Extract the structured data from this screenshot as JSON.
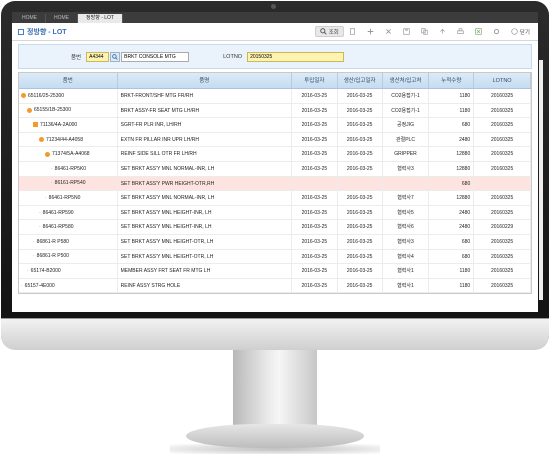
{
  "tabs": [
    {
      "label": "HOME"
    },
    {
      "label": "HOME"
    },
    {
      "label": "정방향 - LOT"
    }
  ],
  "page_title": "정방향 - LOT",
  "toolbar": [
    "조회",
    "",
    "",
    "",
    "",
    "",
    "",
    "",
    "",
    "",
    "닫기"
  ],
  "search": {
    "part_label": "품번",
    "part_code": "A4344",
    "part_name": "BRKT CONSOLE MTG",
    "lot_label": "LOTNO",
    "lot_value": "20150325"
  },
  "grid": {
    "headers": [
      "품번",
      "품명",
      "투입일자",
      "생산/입고일자",
      "생산처/입고처",
      "누적수량",
      "LOTNO"
    ],
    "rows": [
      {
        "level": 0,
        "marker": "dot",
        "part_no": "65116/25-25300",
        "name": "BRKT-FRONT/SHF MTG FR/RH",
        "input_date": "2016-03-25",
        "prod_date": "2016-03-25",
        "location": "CO2용접기-1",
        "qty": "1180",
        "lot": "20160325",
        "highlight": false
      },
      {
        "level": 1,
        "marker": "dot",
        "part_no": "65155/1B-25300",
        "name": "BRKT ASSY-FR SEAT MTG LH/RH",
        "input_date": "2016-03-25",
        "prod_date": "2016-03-25",
        "location": "CO2용접기-1",
        "qty": "1180",
        "lot": "20160325",
        "highlight": false
      },
      {
        "level": 2,
        "marker": "sq",
        "part_no": "71136/4A-2A000",
        "name": "SGRT-FR PLR INR, LH/RH",
        "input_date": "2016-03-25",
        "prod_date": "2016-03-25",
        "location": "공정JIG",
        "qty": "680",
        "lot": "20160325",
        "highlight": false
      },
      {
        "level": 3,
        "marker": "dot",
        "part_no": "71234/44-A4058",
        "name": "EXTN FR PILLAR INR UPR LH/RH",
        "input_date": "2016-03-25",
        "prod_date": "2016-03-25",
        "location": "관절PLC",
        "qty": "2480",
        "lot": "20160325",
        "highlight": false
      },
      {
        "level": 4,
        "marker": "dot",
        "part_no": "71374/5A-A4068",
        "name": "REINF SIDE SILL OTR FR LH/RH",
        "input_date": "2016-03-25",
        "prod_date": "2016-03-25",
        "location": "GRIPPER",
        "qty": "12880",
        "lot": "20160325",
        "highlight": false
      },
      {
        "level": 5,
        "marker": "leaf",
        "part_no": "86461-RP5K0",
        "name": "SET BRKT ASS'Y MNL NORMAL-INR, LH",
        "input_date": "2016-03-25",
        "prod_date": "2016-03-25",
        "location": "협력사3",
        "qty": "12880",
        "lot": "20160325",
        "highlight": false
      },
      {
        "level": 5,
        "marker": "leaf",
        "part_no": "86161-RP540",
        "name": "SET BRKT ASS'Y PWR HEIGHT-OTR,RH",
        "input_date": "",
        "prod_date": "",
        "location": "",
        "qty": "680",
        "lot": "",
        "highlight": true
      },
      {
        "level": 4,
        "marker": "leaf",
        "part_no": "86461-RP5N0",
        "name": "SET BRKT ASS'Y MNL NORMAL-INR, LH",
        "input_date": "2016-03-25",
        "prod_date": "2016-03-25",
        "location": "협력사7",
        "qty": "12880",
        "lot": "20160325",
        "highlight": false
      },
      {
        "level": 3,
        "marker": "leaf",
        "part_no": "86461-RP590",
        "name": "SET BRKT ASS'Y MNL HEIGHT-INR, LH",
        "input_date": "2016-03-25",
        "prod_date": "2016-03-25",
        "location": "협력사5",
        "qty": "2480",
        "lot": "20160325",
        "highlight": false
      },
      {
        "level": 3,
        "marker": "leaf",
        "part_no": "86461-RP580",
        "name": "SET BRKT ASS'Y MNL HEIGHT-INR, LH",
        "input_date": "2016-03-25",
        "prod_date": "2016-03-25",
        "location": "협력사6",
        "qty": "2480",
        "lot": "20160229",
        "highlight": false
      },
      {
        "level": 2,
        "marker": "leaf",
        "part_no": "86861-R P580",
        "name": "SET BRKT ASS'Y MNL HEIGHT-OTR, LH",
        "input_date": "2016-03-25",
        "prod_date": "2016-03-25",
        "location": "협력사3",
        "qty": "680",
        "lot": "20160325",
        "highlight": false
      },
      {
        "level": 2,
        "marker": "leaf",
        "part_no": "86861-R P500",
        "name": "SET BRKT ASS'Y MNL HEIGHT-OTR, LH",
        "input_date": "2016-03-25",
        "prod_date": "2016-03-25",
        "location": "협력사4",
        "qty": "680",
        "lot": "20160325",
        "highlight": false
      },
      {
        "level": 1,
        "marker": "leaf",
        "part_no": "65174-B2000",
        "name": "MEMBER ASSY FRT SEAT FR MTG LH",
        "input_date": "2016-03-25",
        "prod_date": "2016-03-25",
        "location": "협력사1",
        "qty": "1180",
        "lot": "20160325",
        "highlight": false
      },
      {
        "level": 0,
        "marker": "leaf",
        "part_no": "65157-4E000",
        "name": "REINF ASSY STRG HOLE",
        "input_date": "2016-03-25",
        "prod_date": "2016-03-25",
        "location": "협력사1",
        "qty": "1180",
        "lot": "20160325",
        "highlight": false
      }
    ]
  }
}
